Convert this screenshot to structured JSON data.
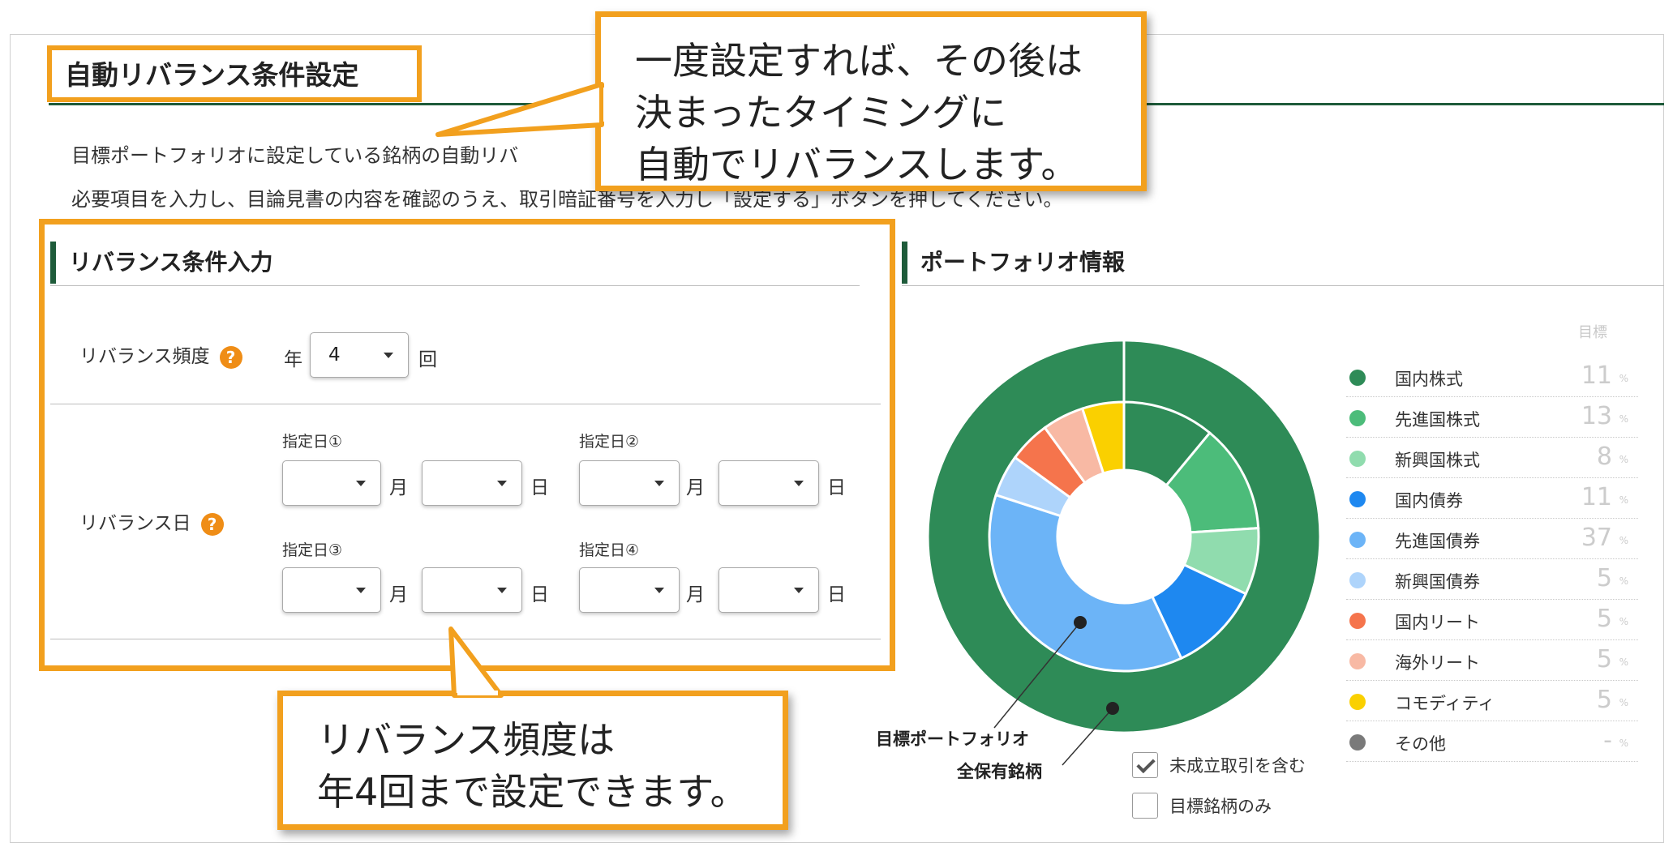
{
  "section_title": "自動リバランス条件設定",
  "description": {
    "line1": "目標ポートフォリオに設定している銘柄の自動リバ",
    "line2": "必要項目を入力し、目論見書の内容を確認のうえ、取引暗証番号を入力し「設定する」ボタンを押してください。"
  },
  "callouts": {
    "top": [
      "一度設定すれば、その後は",
      "決まったタイミングに",
      "自動でリバランスします。"
    ],
    "bottom": [
      "リバランス頻度は",
      "年4回まで設定できます。"
    ]
  },
  "rebalance_input": {
    "heading": "リバランス条件入力",
    "help_glyph": "?",
    "frequency": {
      "label": "リバランス頻度",
      "prefix": "年",
      "value": "4",
      "suffix": "回"
    },
    "date_row_label": "リバランス日",
    "month_unit": "月",
    "day_unit": "日",
    "dates": [
      {
        "label": "指定日①",
        "month": "",
        "day": ""
      },
      {
        "label": "指定日②",
        "month": "",
        "day": ""
      },
      {
        "label": "指定日③",
        "month": "",
        "day": ""
      },
      {
        "label": "指定日④",
        "month": "",
        "day": ""
      }
    ]
  },
  "portfolio_info": {
    "heading": "ポートフォリオ情報",
    "legend_header": "目標",
    "pct_sign": "%",
    "inner_ring_label": "目標ポートフォリオ",
    "outer_ring_label": "全保有銘柄",
    "checkboxes": [
      {
        "label": "未成立取引を含む",
        "checked": true
      },
      {
        "label": "目標銘柄のみ",
        "checked": false
      }
    ]
  },
  "chart_data": {
    "type": "pie",
    "series": [
      {
        "name": "目標ポートフォリオ",
        "values": [
          11,
          13,
          8,
          11,
          37,
          5,
          5,
          5,
          5,
          null
        ]
      },
      {
        "name": "全保有銘柄",
        "values": [
          100,
          0,
          0,
          0,
          0,
          0,
          0,
          0,
          0,
          0
        ]
      }
    ],
    "categories": [
      "国内株式",
      "先進国株式",
      "新興国株式",
      "国内債券",
      "先進国債券",
      "新興国債券",
      "国内リート",
      "海外リート",
      "コモディティ",
      "その他"
    ],
    "display_values": [
      "11",
      "13",
      "8",
      "11",
      "37",
      "5",
      "5",
      "5",
      "5",
      "-"
    ],
    "colors": [
      "#2e8b57",
      "#4cbc7a",
      "#90dcae",
      "#1e88f0",
      "#6cb4f7",
      "#aed4fb",
      "#f5744c",
      "#f8b9a4",
      "#fad000",
      "#7a7a7a"
    ],
    "legend_position": "right"
  }
}
